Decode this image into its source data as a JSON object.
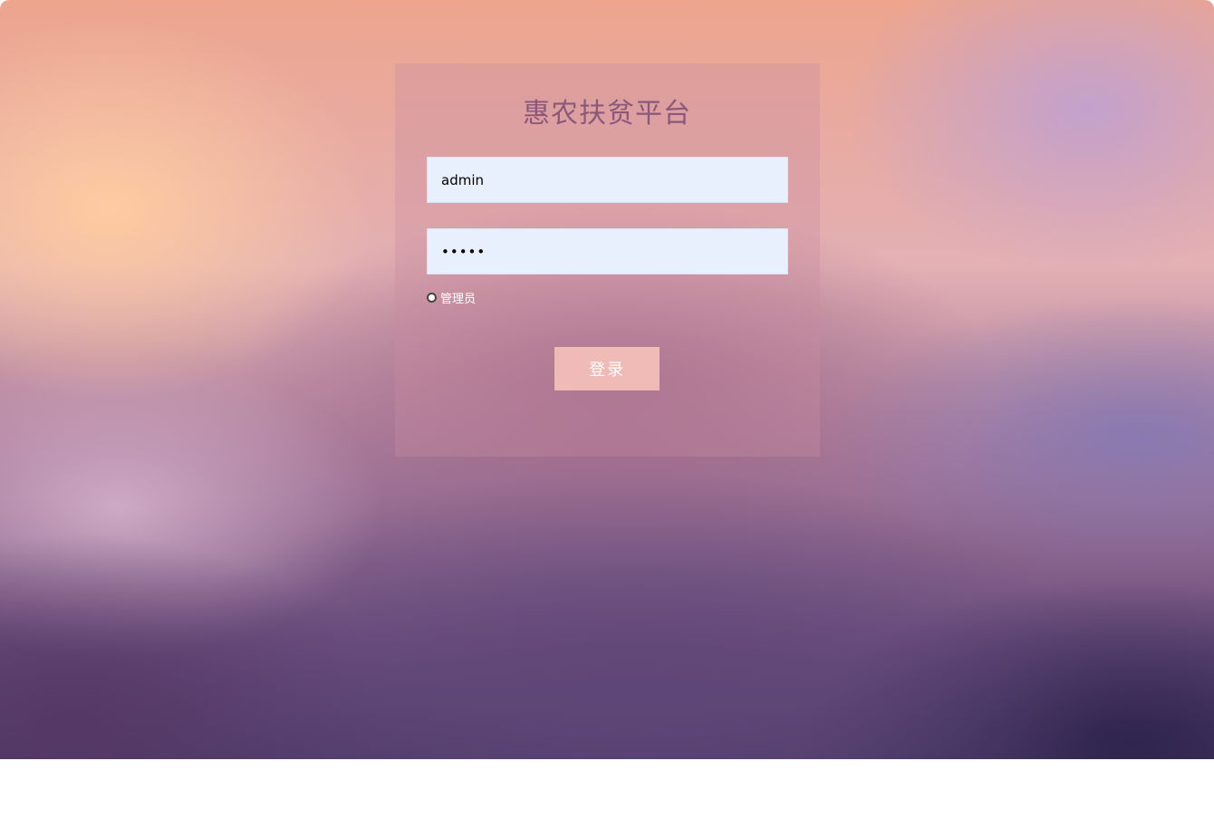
{
  "app": {
    "title": "惠农扶贫平台"
  },
  "login": {
    "username_value": "admin",
    "password_value": "•••••",
    "role_label": "管理员",
    "submit_label": "登录"
  },
  "colors": {
    "title": "#8a587a",
    "button": "#f0bab6",
    "input_bg": "#e8f0fe"
  }
}
